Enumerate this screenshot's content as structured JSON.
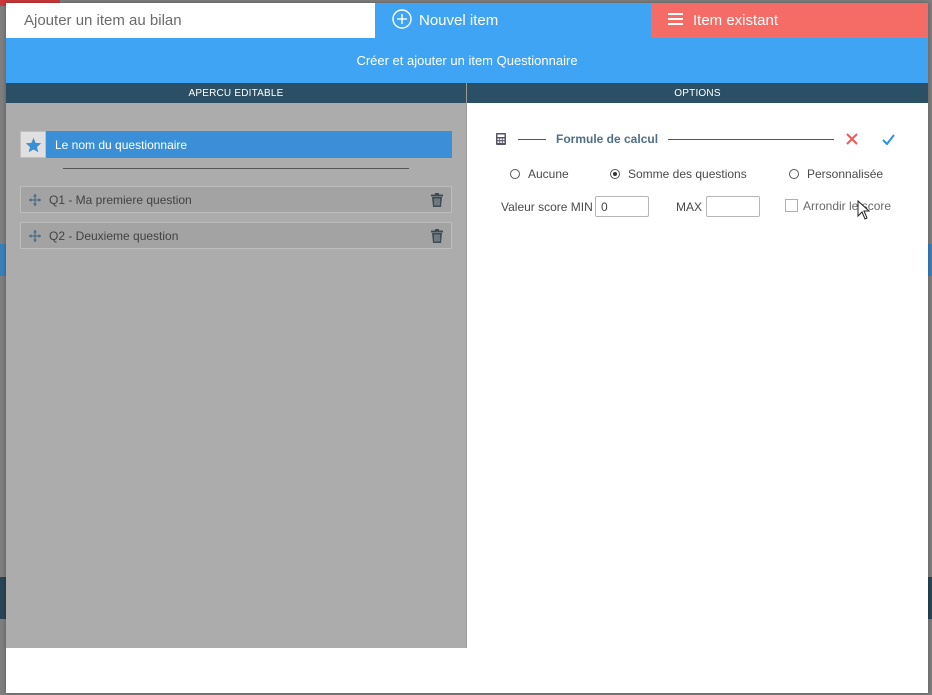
{
  "tabs": {
    "title": "Ajouter un item au bilan",
    "new_item": "Nouvel item",
    "existing_item": "Item existant"
  },
  "subheader": "Créer et ajouter un item Questionnaire",
  "columns": {
    "preview": "APERCU EDITABLE",
    "options": "OPTIONS"
  },
  "preview": {
    "questionnaire_name": "Le nom du questionnaire",
    "questions": [
      {
        "label": "Q1 - Ma premiere question"
      },
      {
        "label": "Q2 - Deuxieme question"
      }
    ]
  },
  "options": {
    "formule_label": "Formule de calcul",
    "radios": [
      {
        "label": "Aucune",
        "selected": false
      },
      {
        "label": "Somme des questions",
        "selected": true
      },
      {
        "label": "Personnalisée",
        "selected": false
      }
    ],
    "min_label": "Valeur score MIN",
    "min_value": "0",
    "max_label": "MAX",
    "max_value": "",
    "round_label": "Arrondir le score",
    "round_checked": false
  },
  "colors": {
    "primary": "#3fa4f4",
    "danger": "#f56c66",
    "header_dark": "#2b5066"
  },
  "icons": {
    "new_item": "plus-circle-icon",
    "existing_item": "hamburger-icon",
    "star": "star-icon",
    "move": "move-arrows-icon",
    "trash": "trash-icon",
    "calculator": "calculator-icon",
    "cancel": "close-icon",
    "confirm": "check-icon"
  }
}
